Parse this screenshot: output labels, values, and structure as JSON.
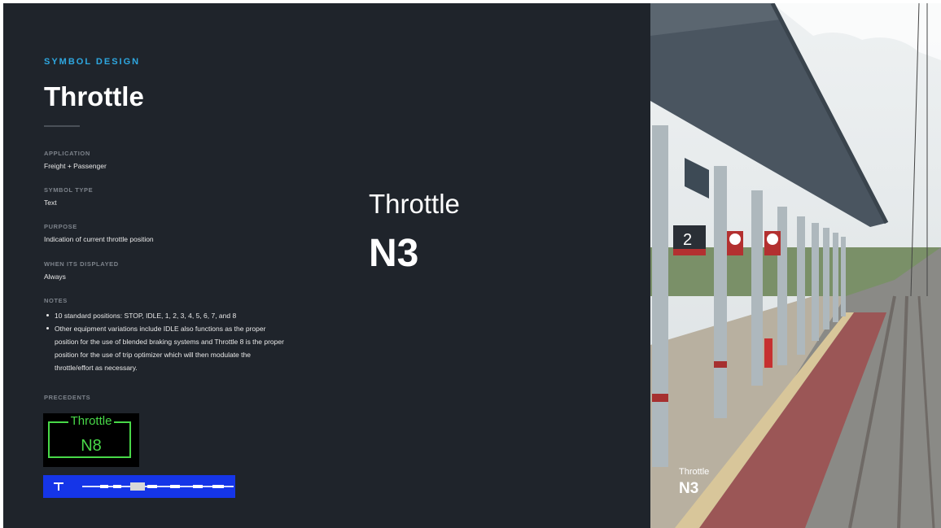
{
  "header": {
    "eyebrow": "SYMBOL DESIGN",
    "title": "Throttle"
  },
  "fields": {
    "application": {
      "label": "APPLICATION",
      "value": "Freight + Passenger"
    },
    "symbol_type": {
      "label": "SYMBOL TYPE",
      "value": "Text"
    },
    "purpose": {
      "label": "PURPOSE",
      "value": "Indication of current throttle position"
    },
    "when_displayed": {
      "label": "WHEN ITS DISPLAYED",
      "value": "Always"
    }
  },
  "notes": {
    "label": "NOTES",
    "items": [
      "10 standard positions: STOP, IDLE, 1, 2, 3, 4, 5, 6, 7, and 8",
      "Other equipment variations include IDLE also functions as the proper position for the use of blended braking systems and Throttle 8 is the proper position for the use of trip optimizer which will then modulate the throttle/effort as necessary."
    ]
  },
  "precedents": {
    "label": "PRECEDENTS",
    "green_display": {
      "label": "Throttle",
      "value": "N8"
    }
  },
  "symbol": {
    "label": "Throttle",
    "value": "N3"
  },
  "photo_overlay": {
    "label": "Throttle",
    "value": "N3",
    "platform_sign": "2"
  },
  "colors": {
    "background": "#1f242b",
    "accent": "#2ea7e0",
    "precedent_green": "#48d848",
    "precedent_blue": "#1535e8"
  }
}
